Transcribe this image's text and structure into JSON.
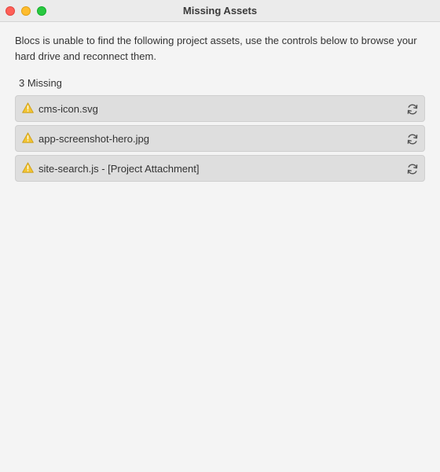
{
  "window": {
    "title": "Missing Assets"
  },
  "message": "Blocs is unable to find the following project assets, use the controls below to browse your hard drive and reconnect them.",
  "missing_count_label": "3 Missing",
  "assets": [
    {
      "name": "cms-icon.svg",
      "status_icon": "warning-icon",
      "action_icon": "refresh-icon"
    },
    {
      "name": "app-screenshot-hero.jpg",
      "status_icon": "warning-icon",
      "action_icon": "refresh-icon"
    },
    {
      "name": "site-search.js - [Project Attachment]",
      "status_icon": "warning-icon",
      "action_icon": "refresh-icon"
    }
  ],
  "colors": {
    "close": "#fe5f57",
    "minimize": "#febc2e",
    "maximize": "#28c840",
    "warning": "#f2c433"
  }
}
